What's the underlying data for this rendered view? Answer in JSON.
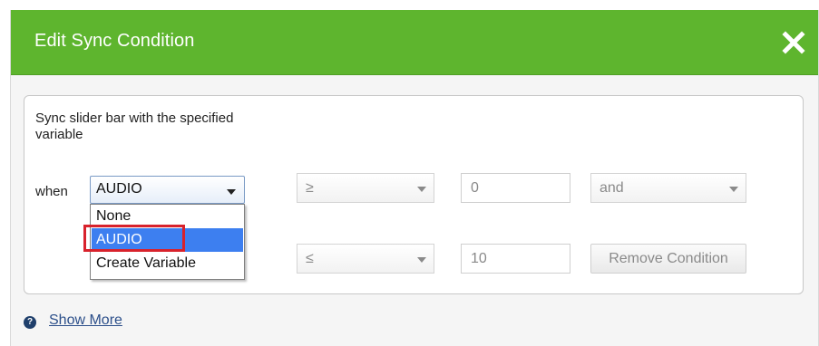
{
  "dialog": {
    "title": "Edit Sync Condition",
    "close_icon": "close-icon",
    "accent_color": "#5eb52e"
  },
  "panel": {
    "description": "Sync slider bar with the specified variable",
    "when_label": "when",
    "variable_select": {
      "value": "AUDIO",
      "options": [
        "None",
        "AUDIO",
        "Create Variable"
      ],
      "highlighted_option": "AUDIO"
    },
    "row1": {
      "operator": "≥",
      "value": "0",
      "conjunction": "and"
    },
    "row2": {
      "operator": "≤",
      "value": "10",
      "remove_label": "Remove Condition"
    }
  },
  "footer": {
    "help_icon": "question-icon",
    "show_more_label": "Show More"
  }
}
